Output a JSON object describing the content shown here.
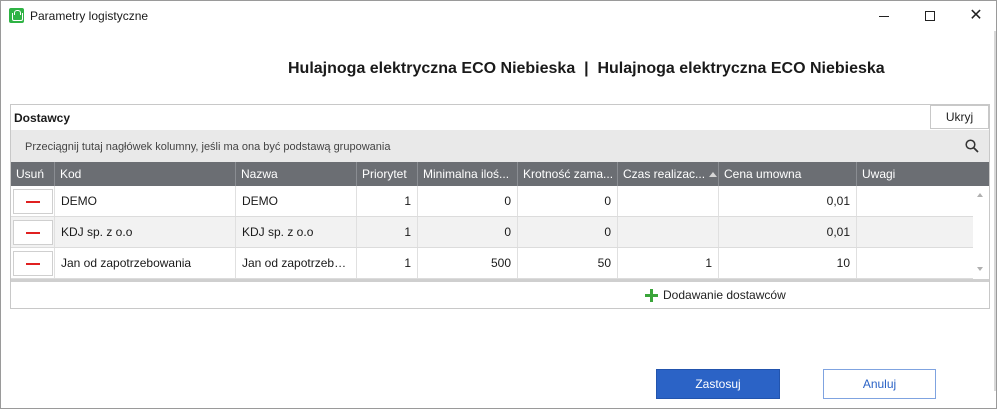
{
  "window": {
    "title": "Parametry logistyczne",
    "icon": "shopping-basket-icon"
  },
  "heading": "Hulajnoga elektryczna ECO Niebieska  |  Hulajnoga elektryczna ECO Niebieska",
  "suppliers": {
    "title": "Dostawcy",
    "hide_label": "Ukryj",
    "group_hint": "Przeciągnij tutaj nagłówek kolumny, jeśli ma ona być podstawą grupowania",
    "columns": [
      "Usuń",
      "Kod",
      "Nazwa",
      "Priorytet",
      "Minimalna iloś...",
      "Krotność zama...",
      "Czas realizac...",
      "Cena umowna",
      "Uwagi"
    ],
    "rows": [
      {
        "kod": "DEMO",
        "nazwa": "DEMO",
        "priorytet": "1",
        "min_ilosc": "0",
        "krotnosc": "0",
        "czas": "",
        "cena": "0,01",
        "uwagi": ""
      },
      {
        "kod": "KDJ sp. z o.o",
        "nazwa": "KDJ sp. z o.o",
        "priorytet": "1",
        "min_ilosc": "0",
        "krotnosc": "0",
        "czas": "",
        "cena": "0,01",
        "uwagi": ""
      },
      {
        "kod": "Jan od zapotrzebowania",
        "nazwa": "Jan od zapotrzebowania",
        "priorytet": "1",
        "min_ilosc": "500",
        "krotnosc": "50",
        "czas": "1",
        "cena": "10",
        "uwagi": ""
      }
    ],
    "add_label": "Dodawanie dostawców"
  },
  "buttons": {
    "apply": "Zastosuj",
    "cancel": "Anuluj"
  }
}
